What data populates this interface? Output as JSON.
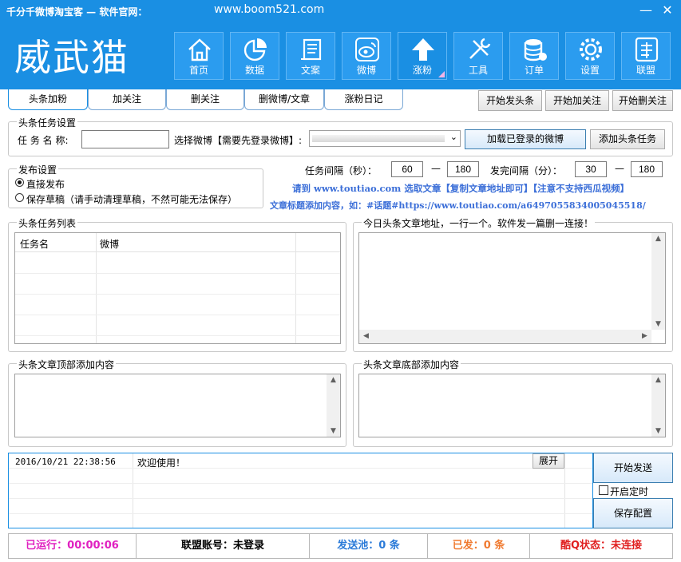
{
  "window": {
    "title": "千分千微博淘宝客 — 软件官网：",
    "url": "www.boom521.com",
    "minimize": "—",
    "close": "✕"
  },
  "header": {
    "logo": "威武猫",
    "nav": [
      {
        "label": "首页",
        "icon": "home-icon"
      },
      {
        "label": "数据",
        "icon": "pie-chart-icon"
      },
      {
        "label": "文案",
        "icon": "scroll-icon"
      },
      {
        "label": "微博",
        "icon": "weibo-icon"
      },
      {
        "label": "涨粉",
        "icon": "arrow-up-icon"
      },
      {
        "label": "工具",
        "icon": "tools-icon"
      },
      {
        "label": "订单",
        "icon": "database-icon"
      },
      {
        "label": "设置",
        "icon": "gear-icon"
      },
      {
        "label": "联盟",
        "icon": "alliance-icon"
      }
    ]
  },
  "tabs": [
    "头条加粉",
    "加关注",
    "删关注",
    "删微博/文章",
    "涨粉日记"
  ],
  "actions": {
    "start_headline": "开始发头条",
    "start_follow": "开始加关注",
    "start_unfollow": "开始删关注"
  },
  "task_settings": {
    "legend": "头条任务设置",
    "name_label": "任 务 名 称:",
    "name_value": "",
    "weibo_label": "选择微博【需要先登录微博】:",
    "load_button": "加载已登录的微博",
    "add_button": "添加头条任务"
  },
  "publish_settings": {
    "legend": "发布设置",
    "options": [
      "直接发布",
      "保存草稿（请手动清理草稿，不然可能无法保存）"
    ],
    "selected": 0
  },
  "intervals": {
    "task_label": "任务间隔（秒）：",
    "task_min": "60",
    "task_max": "180",
    "dash": "—",
    "post_label": "发完间隔（分）：",
    "post_min": "30",
    "post_max": "180"
  },
  "info": {
    "line1": "请到 www.toutiao.com 选取文章【复制文章地址即可】【注意不支持西瓜视频】",
    "line2": "文章标题添加内容，如：#话题#https://www.toutiao.com/a6497055834005045518/"
  },
  "task_list": {
    "legend": "头条任务列表",
    "columns": [
      "任务名",
      "微博"
    ]
  },
  "article_urls": {
    "legend": "今日头条文章地址，一行一个。软件发一篇删一连接！"
  },
  "top_content": {
    "legend": "头条文章顶部添加内容"
  },
  "bottom_content": {
    "legend": "头条文章底部添加内容"
  },
  "log": {
    "rows": [
      {
        "time": "2016/10/21 22:38:56",
        "message": "欢迎使用！"
      }
    ],
    "expand_button": "展开"
  },
  "controls": {
    "start_send": "开始发送",
    "timer_label": "开启定时",
    "save_config": "保存配置"
  },
  "status": {
    "running": "已运行：00:00:06",
    "account": "联盟账号：未登录",
    "pool": "发送池：0 条",
    "sent": "已发：0 条",
    "kuq": "酷Q状态：未连接",
    "colors": {
      "running": "#e020c0",
      "account": "#000000",
      "pool": "#2a7ad8",
      "sent": "#f07a30",
      "kuq": "#e02020"
    }
  }
}
